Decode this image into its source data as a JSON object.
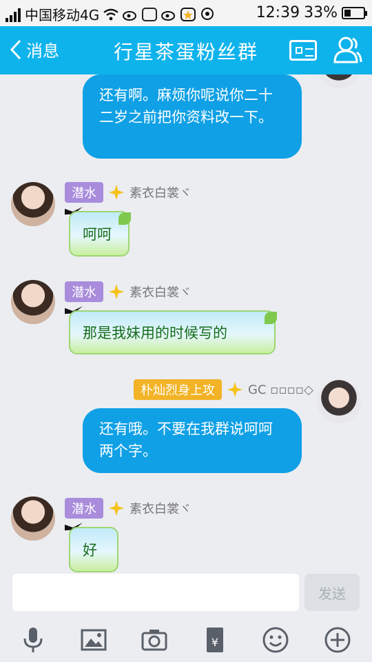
{
  "status_bar": {
    "carrier": "中国移动4G",
    "time": "12:39",
    "battery_percent": 33
  },
  "header": {
    "back_label": "消息",
    "title": "行星茶蛋粉丝群"
  },
  "messages": [
    {
      "side": "right",
      "text": "还有啊。麻烦你呢说你二十二岁之前把你资料改一下。"
    },
    {
      "side": "left",
      "badge": "潜水",
      "nick": "素衣白裳ヾ",
      "sticker_text": "呵呵"
    },
    {
      "side": "left",
      "badge": "潜水",
      "nick": "素衣白裳ヾ",
      "sticker_text": "那是我妹用的时候写的"
    },
    {
      "side": "right",
      "badge": "朴灿烈身上攻",
      "nick": "GC ▫▫▫▫◇",
      "text": "还有哦。不要在我群说呵呵两个字。"
    },
    {
      "side": "left",
      "badge": "潜水",
      "nick": "素衣白裳ヾ",
      "sticker_text": "好"
    }
  ],
  "input": {
    "value": "",
    "send_label": "发送"
  },
  "toolbar": {
    "icons": [
      "microphone-icon",
      "image-icon",
      "camera-icon",
      "red-packet-icon",
      "emoji-icon",
      "plus-icon"
    ]
  },
  "colors": {
    "header_bg": "#0fb3ec",
    "bubble_bg": "#0fa0e6",
    "badge_purple": "#a98cdb",
    "badge_gold": "#f2b326"
  }
}
